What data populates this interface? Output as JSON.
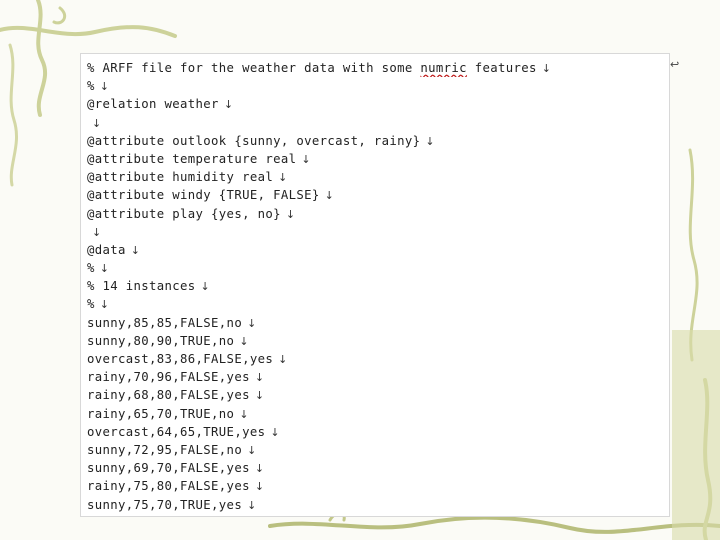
{
  "colors": {
    "background": "#fbfbf6",
    "vine": "#cdd29a",
    "vine_dark": "#b9bf7f",
    "text": "#222222"
  },
  "document": {
    "paragraph_mark": "↓",
    "return_mark": "↩",
    "lines": [
      {
        "pre": "% ARFF file for the weather data with some ",
        "underlined": "numric",
        "post": " features"
      },
      {
        "pre": "%",
        "underlined": "",
        "post": ""
      },
      {
        "pre": "@relation weather",
        "underlined": "",
        "post": ""
      },
      {
        "pre": "",
        "underlined": "",
        "post": ""
      },
      {
        "pre": "@attribute outlook {sunny, overcast, rainy}",
        "underlined": "",
        "post": ""
      },
      {
        "pre": "@attribute temperature real",
        "underlined": "",
        "post": ""
      },
      {
        "pre": "@attribute humidity real",
        "underlined": "",
        "post": ""
      },
      {
        "pre": "@attribute windy {TRUE, FALSE}",
        "underlined": "",
        "post": ""
      },
      {
        "pre": "@attribute play {yes, no}",
        "underlined": "",
        "post": ""
      },
      {
        "pre": "",
        "underlined": "",
        "post": ""
      },
      {
        "pre": "@data",
        "underlined": "",
        "post": ""
      },
      {
        "pre": "%",
        "underlined": "",
        "post": ""
      },
      {
        "pre": "% 14 instances",
        "underlined": "",
        "post": ""
      },
      {
        "pre": "%",
        "underlined": "",
        "post": ""
      },
      {
        "pre": "sunny,85,85,FALSE,no",
        "underlined": "",
        "post": ""
      },
      {
        "pre": "sunny,80,90,TRUE,no",
        "underlined": "",
        "post": ""
      },
      {
        "pre": "overcast,83,86,FALSE,yes",
        "underlined": "",
        "post": ""
      },
      {
        "pre": "rainy,70,96,FALSE,yes",
        "underlined": "",
        "post": ""
      },
      {
        "pre": "rainy,68,80,FALSE,yes",
        "underlined": "",
        "post": ""
      },
      {
        "pre": "rainy,65,70,TRUE,no",
        "underlined": "",
        "post": ""
      },
      {
        "pre": "overcast,64,65,TRUE,yes",
        "underlined": "",
        "post": ""
      },
      {
        "pre": "sunny,72,95,FALSE,no",
        "underlined": "",
        "post": ""
      },
      {
        "pre": "sunny,69,70,FALSE,yes",
        "underlined": "",
        "post": ""
      },
      {
        "pre": "rainy,75,80,FALSE,yes",
        "underlined": "",
        "post": ""
      },
      {
        "pre": "sunny,75,70,TRUE,yes",
        "underlined": "",
        "post": ""
      }
    ]
  }
}
